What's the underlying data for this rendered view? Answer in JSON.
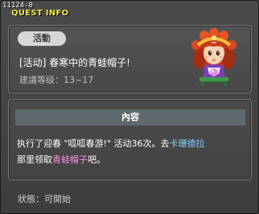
{
  "window": {
    "code": "11124-0",
    "title": "QUEST INFO"
  },
  "quest": {
    "tag": "活動",
    "name": "[活动] 春寒中的青蛙帽子!",
    "level": "建議等级：13~17"
  },
  "content": {
    "header": "內容",
    "desc_1": "执行了迎春 \"呱呱春游!\" 活动36次。去",
    "npc_name": "卡珊德拉",
    "desc_2": "那里领取",
    "item_name": "青蛙帽子",
    "desc_3": "吧。"
  },
  "status": {
    "text": "狀態：可開始"
  },
  "colors": {
    "title": "#f2e64a",
    "npc_highlight": "#7fd6ff",
    "item_highlight": "#ff8ee8"
  }
}
